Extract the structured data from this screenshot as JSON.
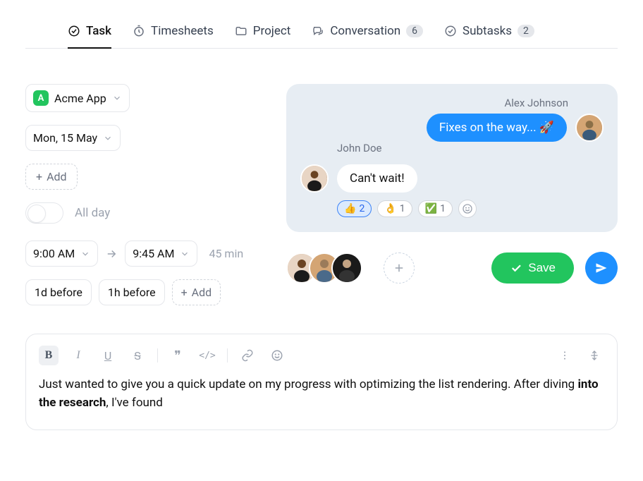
{
  "tabs": [
    {
      "label": "Task",
      "icon": "check-circle",
      "active": true
    },
    {
      "label": "Timesheets",
      "icon": "stopwatch"
    },
    {
      "label": "Project",
      "icon": "folder"
    },
    {
      "label": "Conversation",
      "icon": "chat",
      "badge": "6"
    },
    {
      "label": "Subtasks",
      "icon": "check-circle",
      "badge": "2"
    }
  ],
  "project": {
    "name": "Acme App",
    "badge_letter": "A"
  },
  "date": {
    "label": "Mon, 15 May"
  },
  "add_label": "Add",
  "all_day": {
    "label": "All day",
    "on": false
  },
  "time": {
    "start": "9:00 AM",
    "end": "9:45 AM",
    "duration": "45 min"
  },
  "reminders": [
    "1d before",
    "1h before"
  ],
  "conversation": {
    "right": {
      "sender": "Alex Johnson",
      "text": "Fixes on the way... 🚀"
    },
    "left": {
      "sender": "John Doe",
      "text": "Can't wait!"
    },
    "reactions": [
      {
        "emoji": "👍",
        "count": "2",
        "active": true
      },
      {
        "emoji": "👌",
        "count": "1"
      },
      {
        "emoji": "✅",
        "count": "1"
      }
    ]
  },
  "participants_count": 3,
  "save_label": "Save",
  "editor": {
    "text_before": "Just wanted to give you a quick update on my progress with optimizing the list rendering. After diving ",
    "text_bold": "into the research",
    "text_after": ", I've found"
  }
}
